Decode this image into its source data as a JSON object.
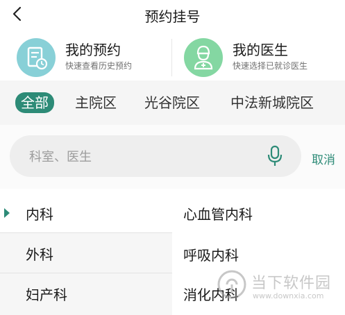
{
  "header": {
    "title": "预约挂号",
    "back_icon": "chevron-left-icon"
  },
  "cards": [
    {
      "title": "我的预约",
      "subtitle": "快速查看历史预约",
      "icon": "calendar-clock-icon",
      "color": "#88d0d7"
    },
    {
      "title": "我的医生",
      "subtitle": "快速选择已就诊医生",
      "icon": "doctor-icon",
      "color": "#84d7a2"
    }
  ],
  "tabs": [
    "全部",
    "主院区",
    "光谷院区",
    "中法新城院区"
  ],
  "active_tab": "全部",
  "search": {
    "placeholder": "科室、医生",
    "mic_icon": "microphone-icon",
    "cancel_label": "取消"
  },
  "departments": [
    "内科",
    "外科",
    "妇产科"
  ],
  "selected_department": "内科",
  "sub_departments": [
    "心血管内科",
    "呼吸内科",
    "消化内科"
  ],
  "watermark": {
    "text": "当下软件园",
    "url": "www.downxia.com"
  },
  "accent_color": "#2d8b77"
}
